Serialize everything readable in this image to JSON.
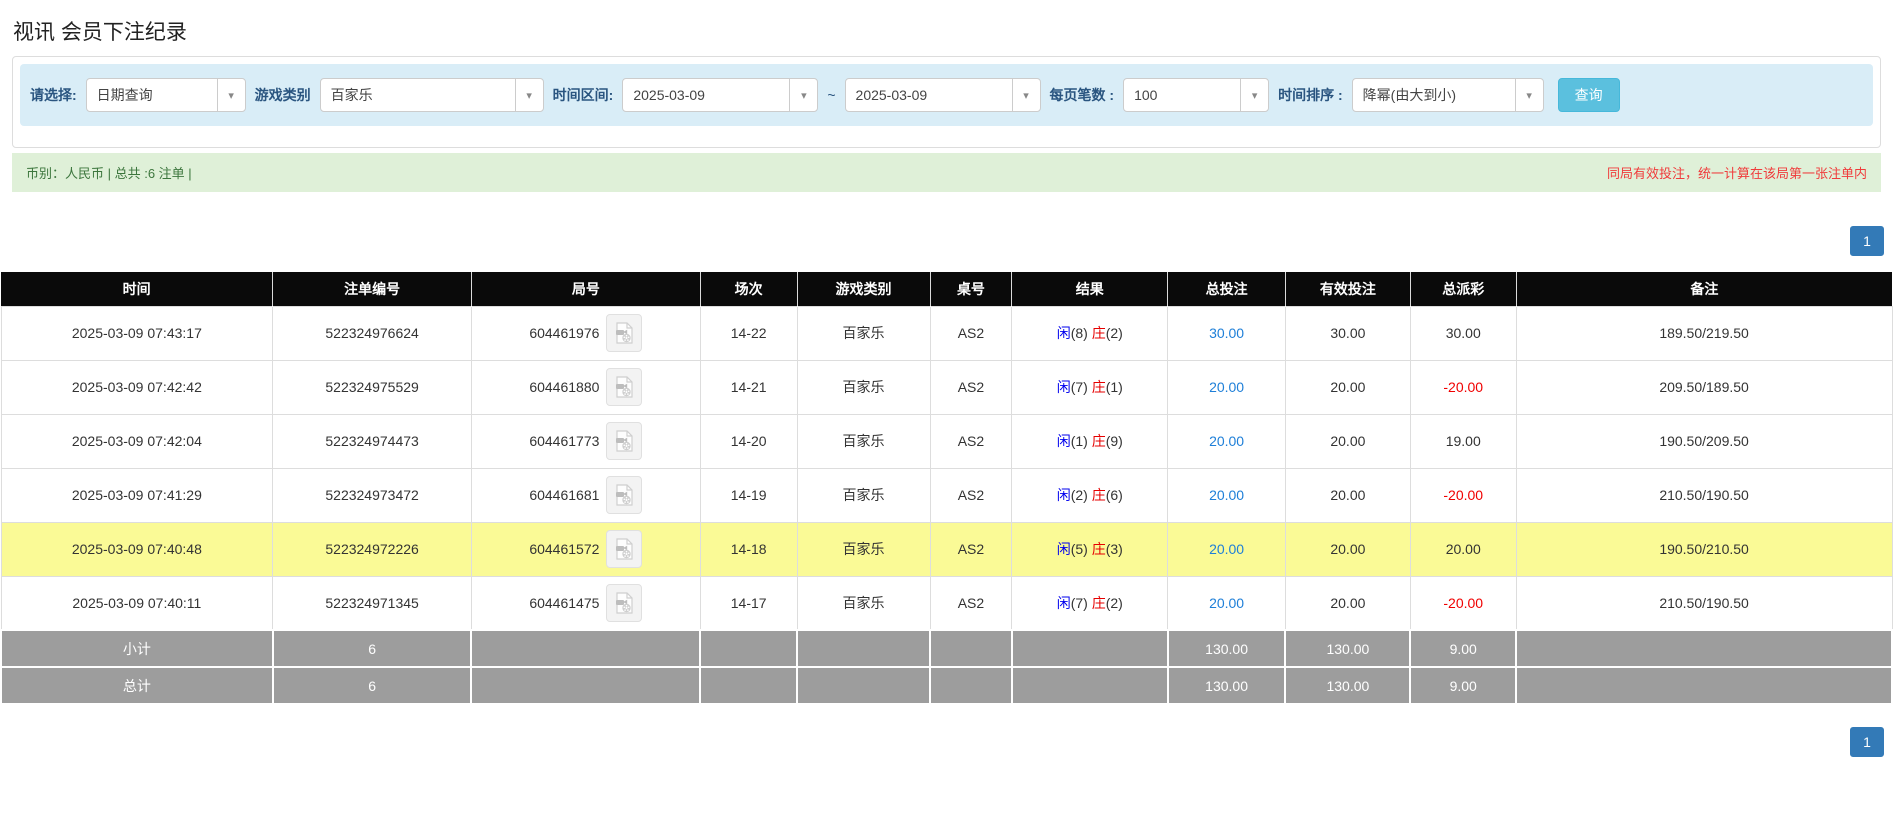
{
  "page": {
    "title": "视讯 会员下注纪录"
  },
  "filters": {
    "select_label": "请选择:",
    "select_value": "日期查询",
    "game_type_label": "游戏类别",
    "game_type_value": "百家乐",
    "time_range_label": "时间区间:",
    "date_from": "2025-03-09",
    "date_to": "2025-03-09",
    "range_separator": "~",
    "per_page_label": "每页笔数 :",
    "per_page_value": "100",
    "sort_label": "时间排序 :",
    "sort_value": "降幂(由大到小)",
    "search_button": "查询"
  },
  "summary": {
    "left_text": "币别：人民币 | 总共 :6 注单 |",
    "right_notice": "同局有效投注，统一计算在该局第一张注单内"
  },
  "pagination": {
    "page": "1"
  },
  "icons": {
    "caret_glyph": "▾",
    "video_icon_name": "video-file-icon"
  },
  "colors": {
    "accent_blue": "#337ab7",
    "info_bg": "#d9edf7",
    "success_bg": "#dff0d8",
    "header_bg": "#0a0a0a",
    "highlight_yellow": "#fafa96",
    "totals_gray": "#9d9d9d",
    "player_blue": "#0000ee",
    "banker_red": "#e60000",
    "negative_red": "#f00000",
    "notice_red": "#f03b3b"
  },
  "table": {
    "headers": [
      "时间",
      "注单编号",
      "局号",
      "场次",
      "游戏类别",
      "桌号",
      "结果",
      "总投注",
      "有效投注",
      "总派彩",
      "备注"
    ],
    "rows": [
      {
        "time": "2025-03-09 07:43:17",
        "bet_id": "522324976624",
        "round_id": "604461976",
        "session": "14-22",
        "game": "百家乐",
        "table": "AS2",
        "result_player": "闲",
        "result_player_value": "(8)",
        "result_banker": "庄",
        "result_banker_value": "(2)",
        "total_bet": "30.00",
        "valid_bet": "30.00",
        "payout": "30.00",
        "remark": "189.50/219.50",
        "highlight": false
      },
      {
        "time": "2025-03-09 07:42:42",
        "bet_id": "522324975529",
        "round_id": "604461880",
        "session": "14-21",
        "game": "百家乐",
        "table": "AS2",
        "result_player": "闲",
        "result_player_value": "(7)",
        "result_banker": "庄",
        "result_banker_value": "(1)",
        "total_bet": "20.00",
        "valid_bet": "20.00",
        "payout": "-20.00",
        "remark": "209.50/189.50",
        "highlight": false
      },
      {
        "time": "2025-03-09 07:42:04",
        "bet_id": "522324974473",
        "round_id": "604461773",
        "session": "14-20",
        "game": "百家乐",
        "table": "AS2",
        "result_player": "闲",
        "result_player_value": "(1)",
        "result_banker": "庄",
        "result_banker_value": "(9)",
        "total_bet": "20.00",
        "valid_bet": "20.00",
        "payout": "19.00",
        "remark": "190.50/209.50",
        "highlight": false
      },
      {
        "time": "2025-03-09 07:41:29",
        "bet_id": "522324973472",
        "round_id": "604461681",
        "session": "14-19",
        "game": "百家乐",
        "table": "AS2",
        "result_player": "闲",
        "result_player_value": "(2)",
        "result_banker": "庄",
        "result_banker_value": "(6)",
        "total_bet": "20.00",
        "valid_bet": "20.00",
        "payout": "-20.00",
        "remark": "210.50/190.50",
        "highlight": false
      },
      {
        "time": "2025-03-09 07:40:48",
        "bet_id": "522324972226",
        "round_id": "604461572",
        "session": "14-18",
        "game": "百家乐",
        "table": "AS2",
        "result_player": "闲",
        "result_player_value": "(5)",
        "result_banker": "庄",
        "result_banker_value": "(3)",
        "total_bet": "20.00",
        "valid_bet": "20.00",
        "payout": "20.00",
        "remark": "190.50/210.50",
        "highlight": true
      },
      {
        "time": "2025-03-09 07:40:11",
        "bet_id": "522324971345",
        "round_id": "604461475",
        "session": "14-17",
        "game": "百家乐",
        "table": "AS2",
        "result_player": "闲",
        "result_player_value": "(7)",
        "result_banker": "庄",
        "result_banker_value": "(2)",
        "total_bet": "20.00",
        "valid_bet": "20.00",
        "payout": "-20.00",
        "remark": "210.50/190.50",
        "highlight": false
      }
    ],
    "subtotal": {
      "label": "小计",
      "count": "6",
      "total_bet": "130.00",
      "valid_bet": "130.00",
      "payout": "9.00"
    },
    "total": {
      "label": "总计",
      "count": "6",
      "total_bet": "130.00",
      "valid_bet": "130.00",
      "payout": "9.00"
    }
  }
}
